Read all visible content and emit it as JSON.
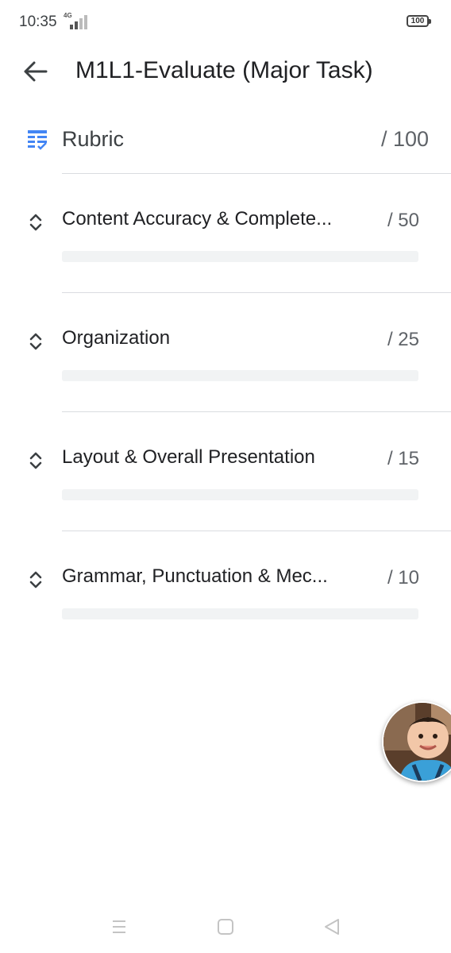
{
  "status_bar": {
    "time": "10:35",
    "network": "4G",
    "battery": "100"
  },
  "app_bar": {
    "back_icon": "arrow-left-icon",
    "title": "M1L1-Evaluate (Major Task)"
  },
  "rubric": {
    "icon": "rubric-table-icon",
    "label": "Rubric",
    "total": "/ 100",
    "criteria": [
      {
        "title": "Content Accuracy & Complete...",
        "points": "/ 50"
      },
      {
        "title": "Organization",
        "points": "/ 25"
      },
      {
        "title": "Layout & Overall Presentation",
        "points": "/ 15"
      },
      {
        "title": "Grammar, Punctuation & Mec...",
        "points": "/ 10"
      }
    ]
  },
  "nav_bar": {
    "items": [
      "menu-icon",
      "home-icon",
      "back-triangle-icon"
    ]
  },
  "colors": {
    "accent": "#4285f4",
    "text_primary": "#202124",
    "text_secondary": "#5f6368",
    "divider": "#dadce0",
    "placeholder_bar": "#f1f3f4"
  }
}
